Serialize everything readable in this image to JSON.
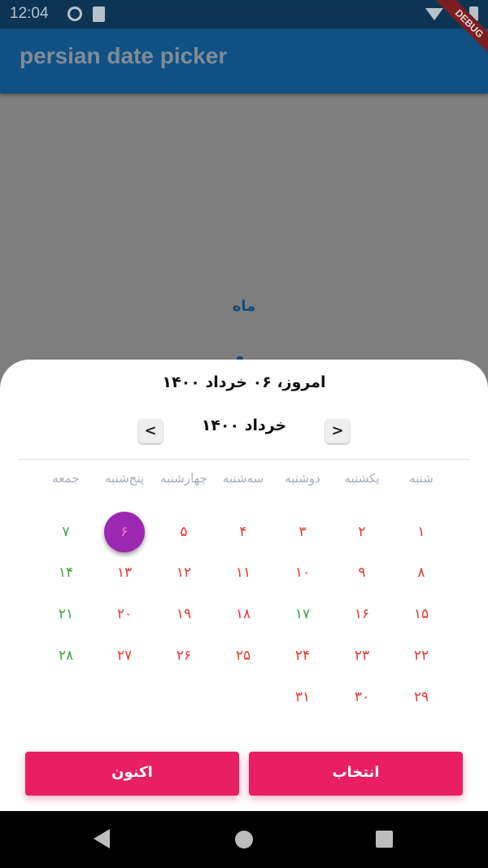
{
  "status_bar": {
    "time": "12:04"
  },
  "app_bar": {
    "title": "persian date picker"
  },
  "debug_banner": "DEBUG",
  "background": {
    "month_label": "ماه"
  },
  "picker": {
    "today_label": "امروز، ۰۶ خرداد ۱۴۰۰",
    "month_label": "خرداد ۱۴۰۰",
    "prev_glyph": "<",
    "next_glyph": ">",
    "weekdays": [
      "شنبه",
      "یکشنبه",
      "دوشنبه",
      "سه‌شنبه",
      "چهارشنبه",
      "پنج‌شنبه",
      "جمعه"
    ],
    "days": [
      "۱",
      "۲",
      "۳",
      "۴",
      "۵",
      "۶",
      "۷",
      "۸",
      "۹",
      "۱۰",
      "۱۱",
      "۱۲",
      "۱۳",
      "۱۴",
      "۱۵",
      "۱۶",
      "۱۷",
      "۱۸",
      "۱۹",
      "۲۰",
      "۲۱",
      "۲۲",
      "۲۳",
      "۲۴",
      "۲۵",
      "۲۶",
      "۲۷",
      "۲۸",
      "۲۹",
      "۳۰",
      "۳۱"
    ],
    "first_weekday_index": 0,
    "selected_day": 6,
    "green_days": [
      7,
      14,
      17,
      21,
      28
    ],
    "select_button": "انتخاب",
    "now_button": "اکنون"
  },
  "colors": {
    "primary": "#1565c0",
    "accent": "#e91e63",
    "selected": "#9c27b0",
    "weekday_day": "#e53935",
    "holiday_day": "#43a047"
  }
}
